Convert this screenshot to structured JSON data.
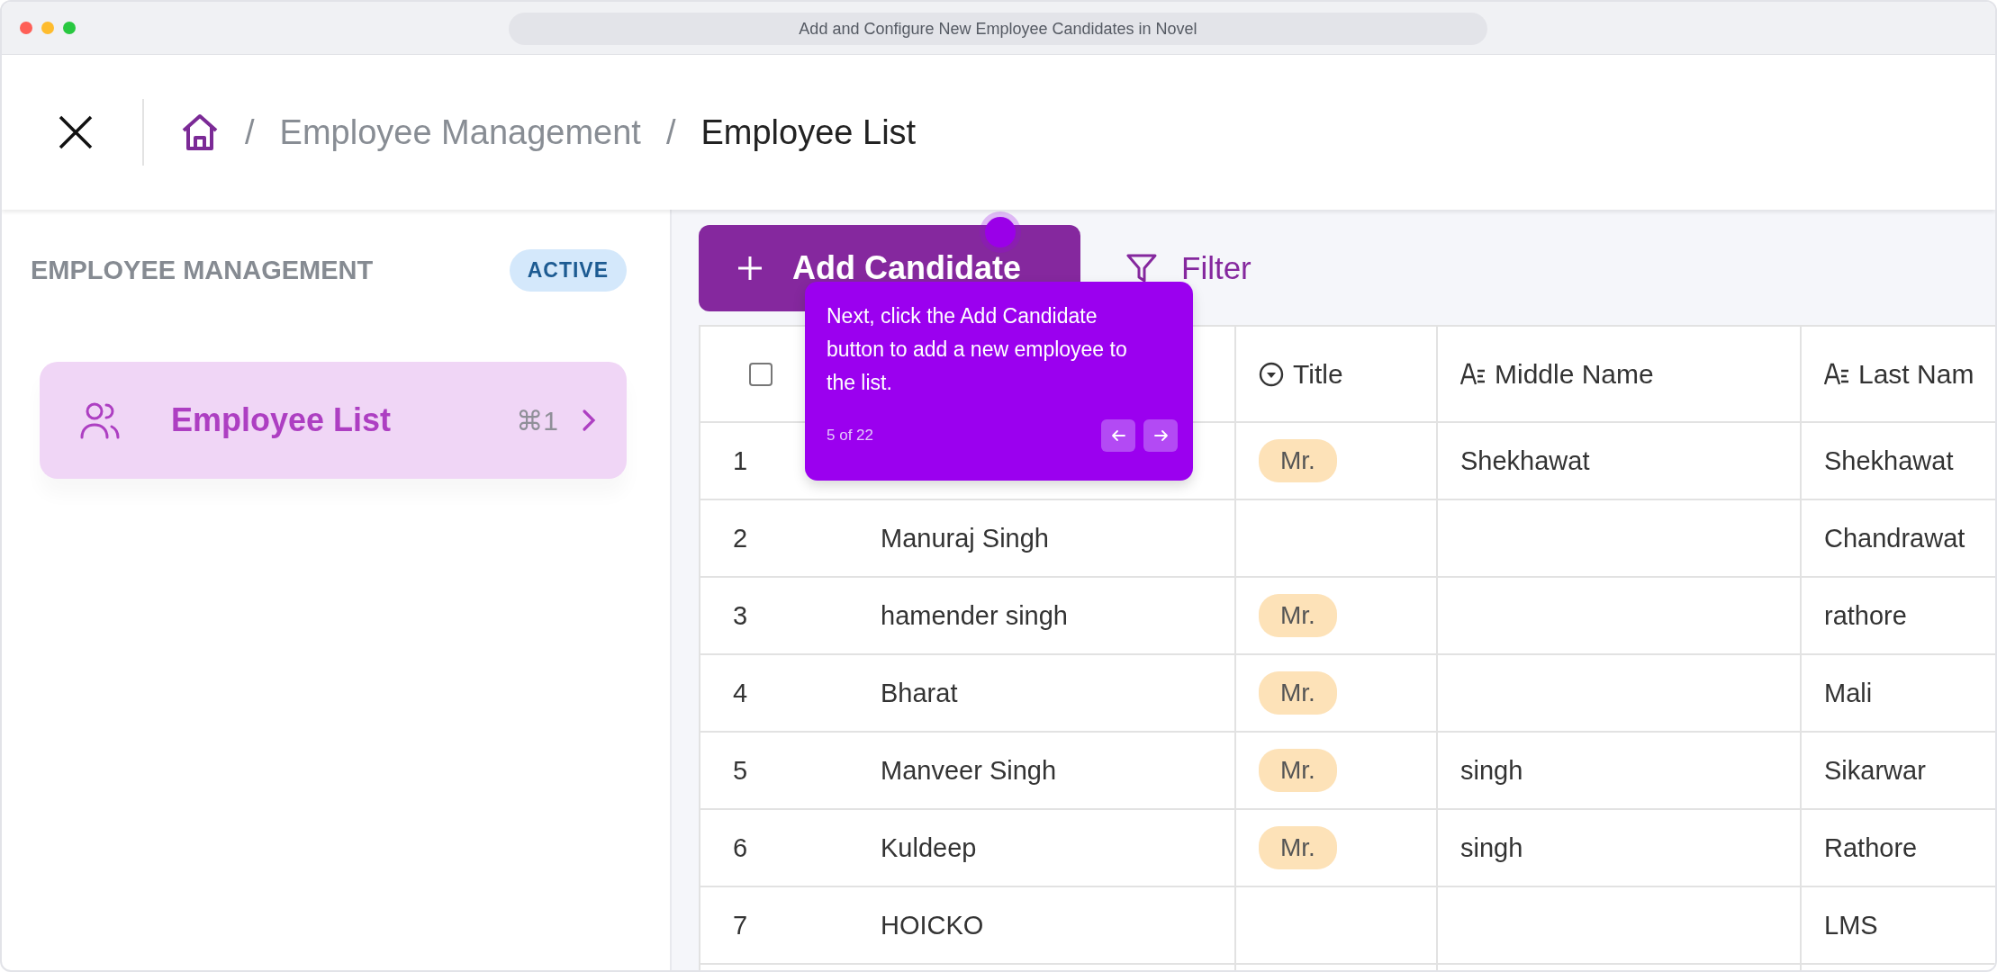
{
  "window": {
    "title": "Add and Configure New Employee Candidates in Novel"
  },
  "breadcrumb": {
    "separator": "/",
    "parent": "Employee Management",
    "current": "Employee List"
  },
  "sidebar": {
    "heading": "EMPLOYEE MANAGEMENT",
    "badge": "ACTIVE",
    "items": [
      {
        "label": "Employee List",
        "shortcut": "⌘1",
        "selected": true
      }
    ]
  },
  "toolbar": {
    "add_button": "Add Candidate",
    "filter": "Filter"
  },
  "table": {
    "select_all": {
      "checked": false
    },
    "columns": [
      {
        "label": "Title",
        "kind": "select"
      },
      {
        "label": "Middle Name",
        "kind": "text"
      },
      {
        "label": "Last Nam",
        "kind": "text"
      }
    ],
    "rows": [
      {
        "number": "1",
        "title": "Mr.",
        "middle_name": "Shekhawat",
        "last_name": "Shekhawat"
      },
      {
        "number": "2",
        "name": "Manuraj Singh",
        "last_name": "Chandrawat"
      },
      {
        "number": "3",
        "name": "hamender singh",
        "title": "Mr.",
        "last_name": "rathore"
      },
      {
        "number": "4",
        "name": "Bharat",
        "title": "Mr.",
        "last_name": "Mali"
      },
      {
        "number": "5",
        "name": "Manveer Singh",
        "title": "Mr.",
        "middle_name": "singh",
        "last_name": "Sikarwar"
      },
      {
        "number": "6",
        "name": "Kuldeep",
        "title": "Mr.",
        "middle_name": "singh",
        "last_name": "Rathore"
      },
      {
        "number": "7",
        "name": "HOICKO",
        "last_name": "LMS"
      }
    ]
  },
  "tour": {
    "text": "Next, click the Add Candidate button to add a new employee to the list.",
    "progress": "5 of 22"
  }
}
